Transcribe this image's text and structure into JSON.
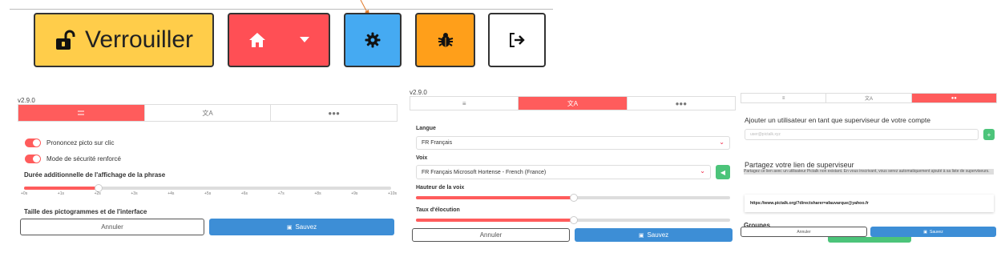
{
  "toolbar": {
    "lock_label": "Verrouiller",
    "lock_icon": "unlock-icon",
    "home_icon": "home-icon",
    "settings_icon": "gear-icon",
    "bug_icon": "bug-icon",
    "exit_icon": "sign-out-icon",
    "colors": {
      "lock": "#ffcd4a",
      "home": "#ff4f55",
      "settings": "#45aaf2",
      "bug": "#ff9f1a",
      "exit": "#ffffff"
    }
  },
  "panel1": {
    "version": "v2.9.0",
    "tabs": [
      {
        "icon": "sliders-icon"
      },
      {
        "icon": "language-icon"
      },
      {
        "icon": "users-icon"
      }
    ],
    "toggles": [
      {
        "label": "Prononcez picto sur clic",
        "on": true
      },
      {
        "label": "Mode de sécurité renforcé",
        "on": true
      }
    ],
    "duration_label": "Durée additionnelle de l'affichage de la phrase",
    "duration_value": 2,
    "duration_ticks": [
      "+0s",
      "+1s",
      "+2s",
      "+3s",
      "+4s",
      "+5s",
      "+6s",
      "+7s",
      "+8s",
      "+9s",
      "+10s"
    ],
    "size_label": "Taille des pictogrammes et de l'interface",
    "cancel": "Annuler",
    "save": "Sauvez"
  },
  "panel2": {
    "version": "v2.9.0",
    "tabs": [
      {
        "icon": "sliders-icon"
      },
      {
        "icon": "language-icon"
      },
      {
        "icon": "users-icon"
      }
    ],
    "language_label": "Langue",
    "language_value": "FR Français",
    "voice_label": "Voix",
    "voice_value": "FR Français Microsoft Hortense - French (France)",
    "pitch_label": "Hauteur de la voix",
    "pitch_value": 0.5,
    "rate_label": "Taux d'élocution",
    "rate_value": 0.5,
    "cancel": "Annuler",
    "save": "Sauvez"
  },
  "panel3": {
    "tabs": [
      {
        "icon": "sliders-icon"
      },
      {
        "icon": "language-icon"
      },
      {
        "icon": "users-icon"
      }
    ],
    "add_supervisor_label": "Ajouter un utilisateur en tant que superviseur de votre compte",
    "email_placeholder": "user@pictalk.xyz",
    "share_label": "Partagez votre lien de superviseur",
    "share_desc": "Partagez ce lien avec un utilisateur Pictalk non existant. En vous inscrivant, vous serez automatiquement ajouté à sa liste de superviseurs.",
    "share_link": "https://www.pictalk.org/?directsharer=afauvarque@yahoo.fr",
    "groups_label": "Groupes",
    "cancel": "Annuler",
    "save": "Sauvez"
  }
}
